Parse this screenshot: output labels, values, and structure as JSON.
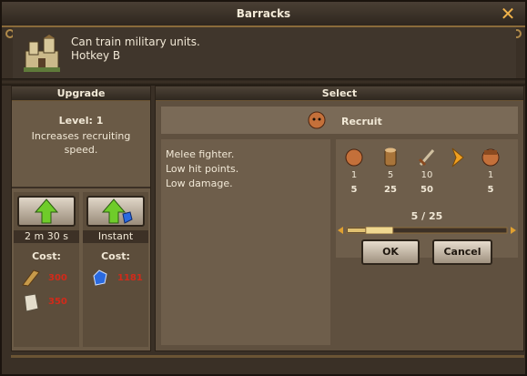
{
  "window": {
    "title": "Barracks",
    "close_icon": "close-icon"
  },
  "info": {
    "description": "Can train military units.",
    "hotkey": "Hotkey B",
    "icon": "barracks-building-icon"
  },
  "upgrade": {
    "header": "Upgrade",
    "level": "Level: 1",
    "description": "Increases recruiting speed.",
    "options": [
      {
        "time": "2 m 30 s",
        "cost_label": "Cost:",
        "icon": "green-arrow-up-icon",
        "costs": [
          {
            "icon": "wood-icon",
            "value": "300"
          },
          {
            "icon": "stone-icon",
            "value": "350"
          }
        ]
      },
      {
        "time": "Instant",
        "cost_label": "Cost:",
        "icon": "green-arrow-gem-icon",
        "costs": [
          {
            "icon": "gem-icon",
            "value": "1181"
          }
        ]
      }
    ]
  },
  "select": {
    "header": "Select",
    "unit": {
      "name": "Recruit",
      "icon": "recruit-portrait-icon"
    },
    "description": [
      "Melee fighter.",
      "Low hit points.",
      "Low damage."
    ],
    "stats": [
      {
        "icon": "population-face-icon",
        "top": "1",
        "bottom": "5"
      },
      {
        "icon": "wood-log-icon",
        "top": "5",
        "bottom": "25"
      },
      {
        "icon": "sword-icon",
        "top": "10",
        "bottom": "50"
      },
      {
        "icon": "arrow-right-icon",
        "top": "",
        "bottom": ""
      },
      {
        "icon": "recruit-face-icon",
        "top": "1",
        "bottom": "5"
      }
    ],
    "quantity": "5 / 25",
    "quantity_fraction": 0.2,
    "ok_label": "OK",
    "cancel_label": "Cancel"
  },
  "colors": {
    "cost_red": "#d22a1a",
    "accent_gold": "#f0b24a"
  }
}
